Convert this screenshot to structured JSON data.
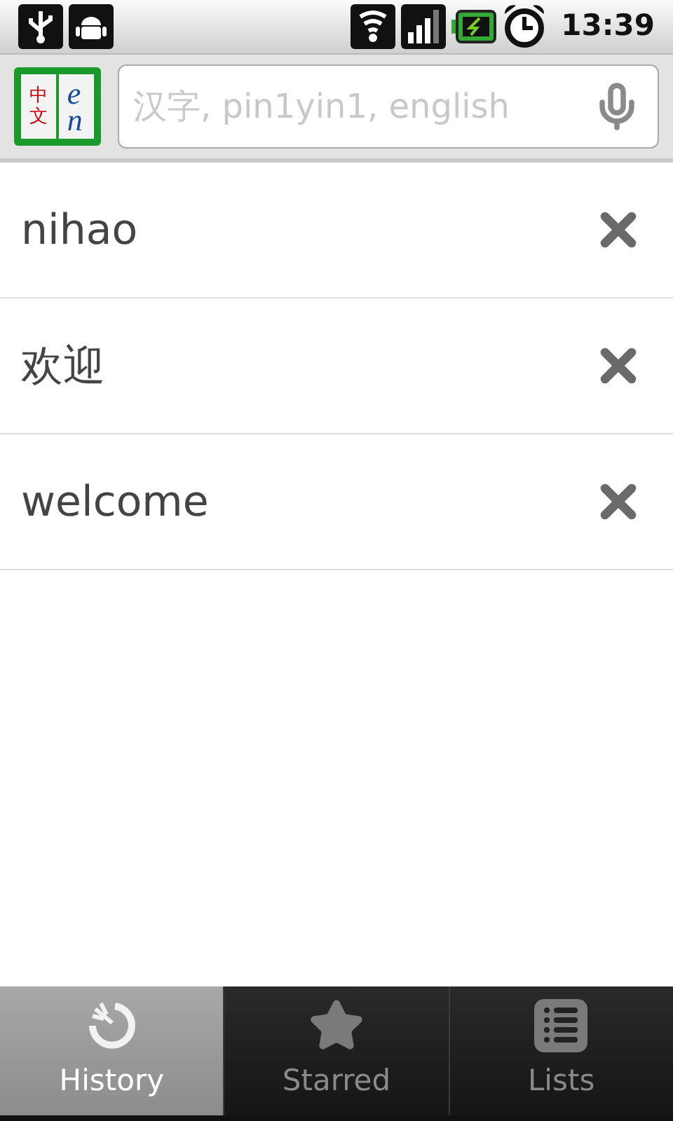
{
  "status_bar": {
    "time": "13:39"
  },
  "header": {
    "logo": {
      "top": "中文",
      "bottom": "en"
    },
    "search": {
      "placeholder": "汉字, pin1yin1, english"
    }
  },
  "history": [
    {
      "text": "nihao"
    },
    {
      "text": "欢迎"
    },
    {
      "text": "welcome"
    }
  ],
  "tabs": [
    {
      "label": "History",
      "selected": true
    },
    {
      "label": "Starred",
      "selected": false
    },
    {
      "label": "Lists",
      "selected": false
    }
  ]
}
